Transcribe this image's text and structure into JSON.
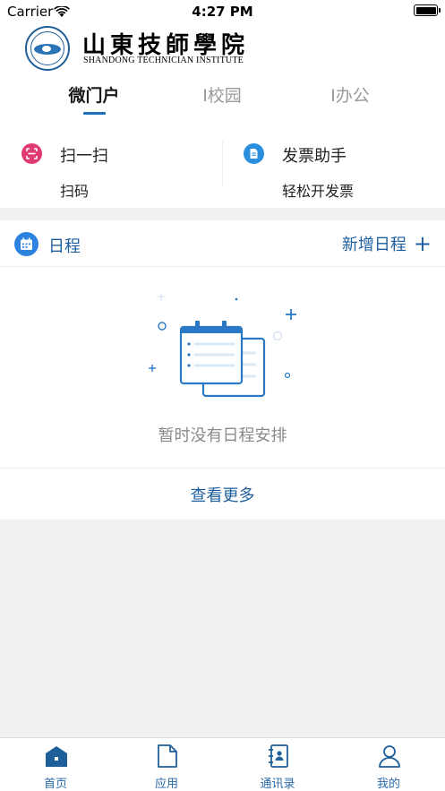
{
  "status_bar": {
    "carrier": "Carrier",
    "time": "4:27 PM"
  },
  "header": {
    "logo_cn": "山東技師學院",
    "logo_en": "SHANDONG TECHNICIAN INSTITUTE",
    "tabs": [
      {
        "label": "微门户",
        "active": true
      },
      {
        "label": "I校园",
        "active": false
      },
      {
        "label": "I办公",
        "active": false
      }
    ]
  },
  "quick_actions": [
    {
      "title": "扫一扫",
      "subtitle": "扫码",
      "icon": "scan-icon",
      "color": "#e03a72"
    },
    {
      "title": "发票助手",
      "subtitle": "轻松开发票",
      "icon": "invoice-icon",
      "color": "#2b8fe0"
    }
  ],
  "schedule": {
    "title": "日程",
    "add_label": "新增日程",
    "add_icon": "+",
    "empty_text": "暂时没有日程安排",
    "more_label": "查看更多"
  },
  "tab_bar": {
    "items": [
      {
        "label": "首页",
        "icon": "home-icon"
      },
      {
        "label": "应用",
        "icon": "document-icon"
      },
      {
        "label": "通讯录",
        "icon": "contacts-icon"
      },
      {
        "label": "我的",
        "icon": "profile-icon"
      }
    ]
  },
  "colors": {
    "accent": "#1d5f9e",
    "tab_blue": "#2a6aa8",
    "scan_pink": "#e03a72",
    "invoice_blue": "#2b8fe0",
    "background": "#f1f1f1"
  }
}
